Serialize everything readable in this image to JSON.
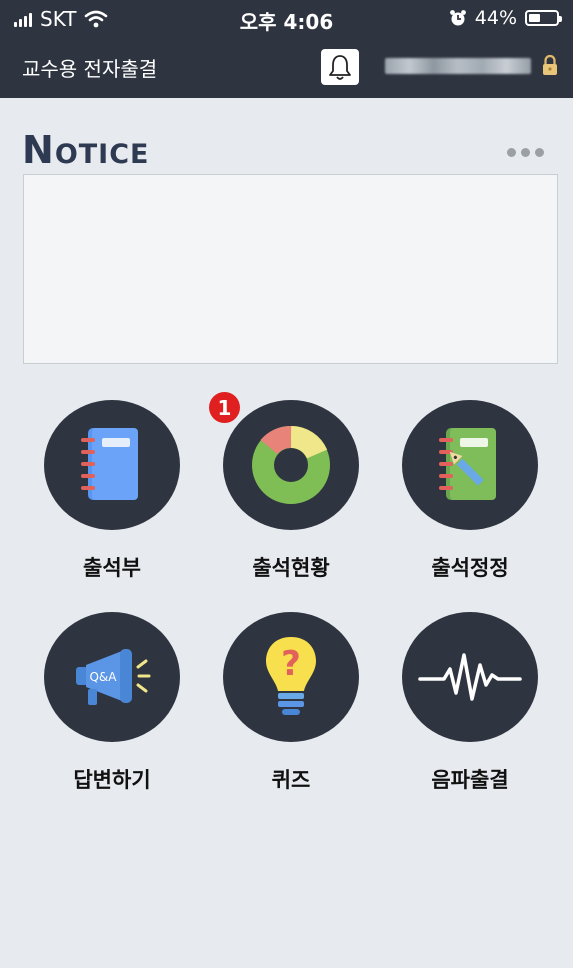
{
  "status_bar": {
    "carrier": "SKT",
    "time": "오후 4:06",
    "battery_percent": "44%",
    "battery_level": 0.44
  },
  "header": {
    "title": "교수용 전자출결"
  },
  "notice": {
    "title_first": "N",
    "title_rest": "OTICE"
  },
  "menu": {
    "attendance_book": "출석부",
    "attendance_status": "출석현황",
    "attendance_status_badge": "1",
    "attendance_correction": "출석정정",
    "answer": "답변하기",
    "quiz": "퀴즈",
    "sound_wave_attendance": "음파출결"
  },
  "icons": {
    "qa_text": "Q&A",
    "quiz_mark": "?"
  },
  "colors": {
    "bar_bg": "#2f3540",
    "page_bg": "#e7ebef",
    "badge": "#e02020",
    "notice_title": "#2e3a52"
  }
}
